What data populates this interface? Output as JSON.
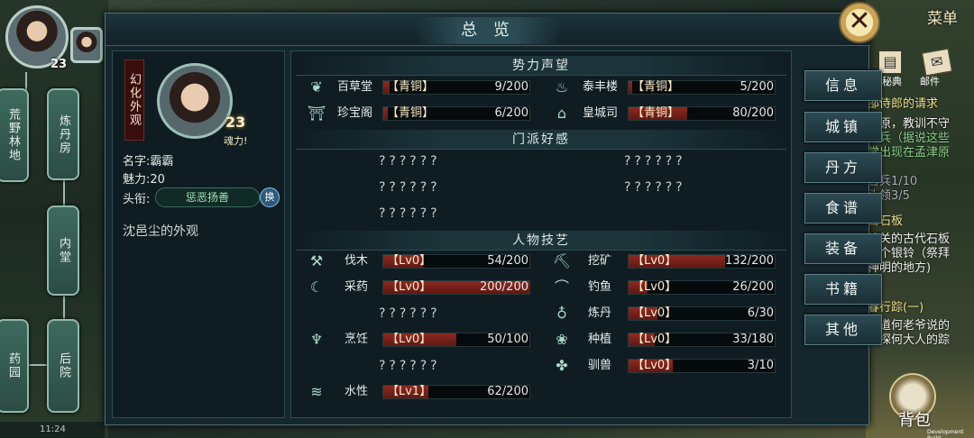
{
  "title": "总 览",
  "top_right": {
    "menu": "菜单",
    "sub1": "秘典",
    "sub2": "邮件",
    "bag": "背包",
    "build": "Development Build"
  },
  "left_map": {
    "level": "23",
    "nodes": [
      "荒野林地",
      "炼丹房",
      "内堂",
      "药园",
      "后院"
    ],
    "time": "11:24"
  },
  "character": {
    "vertical_title": "幻化外观",
    "level": "23",
    "hunli": "魂力!",
    "name_label": "名字:",
    "name": "霸霸",
    "charm_label": "魅力:",
    "charm": "20",
    "title_label": "头衔:",
    "title_value": "惩恶扬善",
    "swap_label": "换",
    "appearance": "沈邑尘的外观"
  },
  "sections": {
    "reputation": "势力声望",
    "affinity": "门派好感",
    "skills": "人物技艺"
  },
  "reputation": [
    {
      "name": "百草堂",
      "rank": "【青铜】",
      "value": "9/200",
      "progress": 0.045,
      "icon": "leaf-icon"
    },
    {
      "name": "泰丰楼",
      "rank": "【青铜】",
      "value": "5/200",
      "progress": 0.025,
      "icon": "bowl-icon"
    },
    {
      "name": "珍宝阁",
      "rank": "【青铜】",
      "value": "6/200",
      "progress": 0.03,
      "icon": "chest-icon"
    },
    {
      "name": "皇城司",
      "rank": "【青铜】",
      "value": "80/200",
      "progress": 0.4,
      "icon": "gate-icon"
    }
  ],
  "affinity": {
    "row1_left": "??????",
    "row1_right": "??????",
    "row2_left": "??????",
    "row2_right": "??????",
    "row3_left": "??????"
  },
  "skills": {
    "logging": {
      "name": "伐木",
      "lv": "【Lv0】",
      "value": "54/200",
      "progress": 0.27,
      "icon": "axe-icon"
    },
    "mining": {
      "name": "挖矿",
      "lv": "【Lv0】",
      "value": "132/200",
      "progress": 0.66,
      "icon": "pickaxe-icon"
    },
    "herb": {
      "name": "采药",
      "lv": "【Lv0】",
      "value": "200/200",
      "progress": 1.0,
      "icon": "sickle-icon"
    },
    "fishing": {
      "name": "钓鱼",
      "lv": "【Lv0】",
      "value": "26/200",
      "progress": 0.13,
      "icon": "fishing-rod-icon"
    },
    "unknown1": "??????",
    "alchemy": {
      "name": "炼丹",
      "lv": "【Lv0】",
      "value": "6/30",
      "progress": 0.2,
      "icon": "cauldron-icon"
    },
    "cooking": {
      "name": "烹饪",
      "lv": "【Lv0】",
      "value": "50/100",
      "progress": 0.5,
      "icon": "pot-icon"
    },
    "planting": {
      "name": "种植",
      "lv": "【Lv0】",
      "value": "33/180",
      "progress": 0.18,
      "icon": "sprout-icon"
    },
    "unknown2": "??????",
    "taming": {
      "name": "驯兽",
      "lv": "【Lv0】",
      "value": "3/10",
      "progress": 0.3,
      "icon": "paw-icon"
    },
    "swimming": {
      "name": "水性",
      "lv": "【Lv1】",
      "value": "62/200",
      "progress": 0.31,
      "icon": "wave-icon"
    }
  },
  "tabs": [
    "信息",
    "城镇",
    "丹方",
    "食谱",
    "装备",
    "书籍",
    "其他"
  ],
  "quests": {
    "q1": "邵侍郎的请求",
    "q2": "津原，教训不守",
    "q3": "官兵（据说这些",
    "q4": "常出现在孟津原",
    "q5": "官兵1/10",
    "q6": "头领3/5",
    "q7": "古石板",
    "q8": "岭关的古代石板",
    "q9": "一个银铃（祭拜",
    "q10": "神明的地方)",
    "q11": "春行踪(一)",
    "q12": "官道何老爷说的",
    "q13": "查探何大人的踪"
  },
  "colors": {
    "bar_fill": "#8c2a22",
    "panel": "#15262c",
    "accent": "#9fe0b4"
  }
}
